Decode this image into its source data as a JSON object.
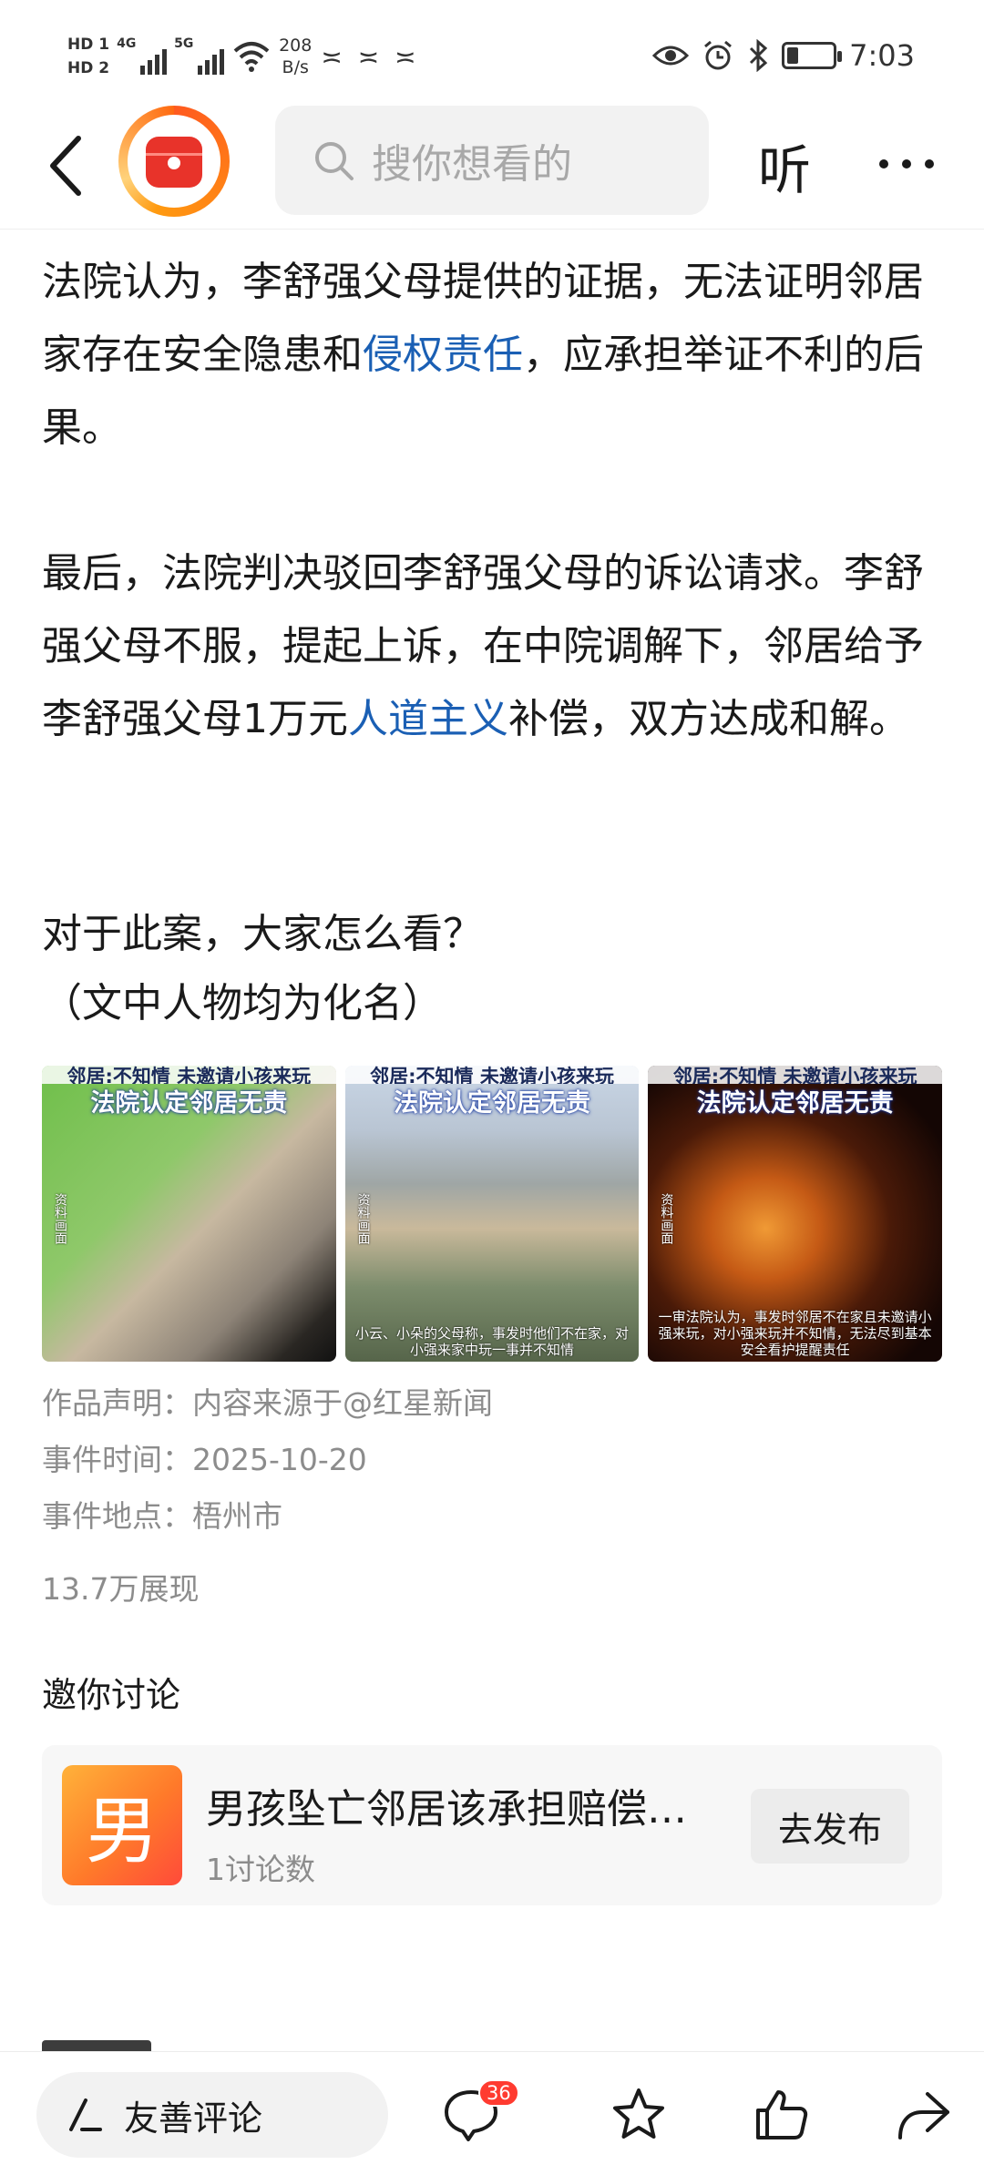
{
  "status_bar": {
    "hd1": "HD 1",
    "hd2": "HD 2",
    "net1": "4G",
    "net2": "5G",
    "speed_value": "208",
    "speed_unit": "B/s",
    "time": "7:03",
    "battery_level": 0.25
  },
  "nav": {
    "search_placeholder": "搜你想看的",
    "listen_label": "听"
  },
  "article": {
    "p1_a": "法院认为，李舒强父母提供的证据，无法证明邻居家存在安全隐患和",
    "p1_link": "侵权责任",
    "p1_b": "，应承担举证不利的后果。",
    "p2_a": "最后，法院判决驳回李舒强父母的诉讼请求。李舒强父母不服，提起上诉，在中院调解下，邻居给予李舒强父母1万元",
    "p2_link": "人道主义",
    "p2_b": "补偿，双方达成和解。",
    "p3_line1": "对于此案，大家怎么看？",
    "p3_line2": "（文中人物均为化名）"
  },
  "images": [
    {
      "caption_top": "邻居:不知情 未邀请小孩来玩",
      "caption_main": "法院认定邻居无责",
      "side": "资料画面",
      "subtitle": ""
    },
    {
      "caption_top": "邻居:不知情 未邀请小孩来玩",
      "caption_main": "法院认定邻居无责",
      "side": "资料画面",
      "subtitle": "小云、小朵的父母称，事发时他们不在家，对小强来家中玩一事并不知情"
    },
    {
      "caption_top": "邻居:不知情 未邀请小孩来玩",
      "caption_main": "法院认定邻居无责",
      "side": "资料画面",
      "subtitle": "一审法院认为，事发时邻居不在家且未邀请小强来玩，对小强来玩并不知情，无法尽到基本安全看护提醒责任"
    }
  ],
  "meta": {
    "statement": "作品声明：内容来源于@红星新闻",
    "event_time": "事件时间：2025-10-20",
    "event_place": "事件地点：梧州市",
    "views": "13.7万展现"
  },
  "discussion": {
    "heading": "邀你讨论",
    "logo_char": "男",
    "topic_title": "男孩坠亡邻居该承担赔偿…",
    "topic_count": "1讨论数",
    "publish_label": "去发布"
  },
  "bottom_bar": {
    "comment_placeholder": "友善评论",
    "comment_count": "36",
    "icons": [
      "pen-icon",
      "comment-icon",
      "star-icon",
      "like-icon",
      "share-icon"
    ]
  },
  "colors": {
    "link": "#1a5fb4",
    "badge": "#ff3b30",
    "ring": "#ff7a1a",
    "app_red": "#e8332a"
  }
}
